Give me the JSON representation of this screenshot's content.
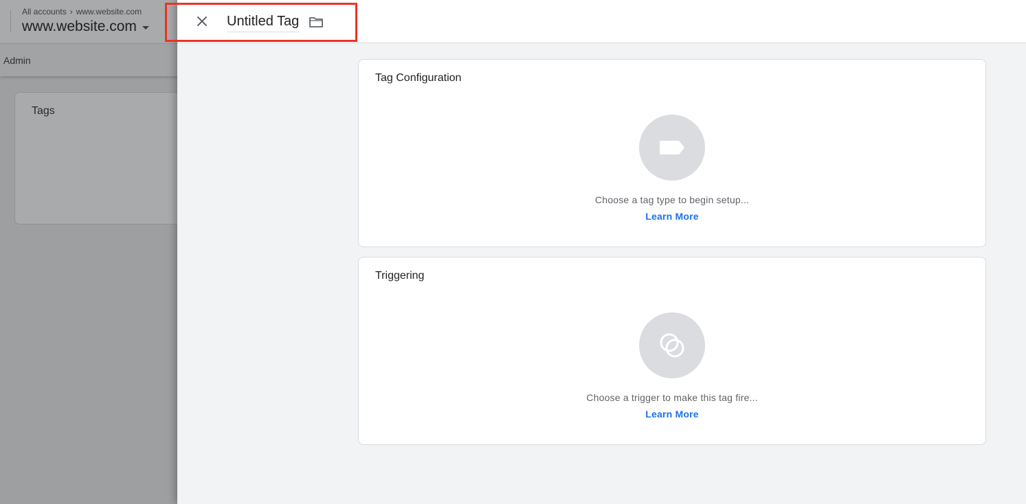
{
  "background": {
    "breadcrumb": {
      "root": "All accounts",
      "current": "www.website.com"
    },
    "container_name": "www.website.com",
    "nav": {
      "admin_label": "Admin"
    },
    "card": {
      "title": "Tags"
    }
  },
  "panel": {
    "title": "Untitled Tag",
    "icons": {
      "close": "close-icon",
      "folder": "folder-icon"
    },
    "highlight_color": "#ea3323",
    "tag_configuration": {
      "title": "Tag Configuration",
      "description": "Choose a tag type to begin setup...",
      "link": "Learn More",
      "icon": "tag-icon"
    },
    "triggering": {
      "title": "Triggering",
      "description": "Choose a trigger to make this tag fire...",
      "link": "Learn More",
      "icon": "trigger-icon"
    }
  },
  "colors": {
    "link": "#1a73e8",
    "circle": "#dadce0",
    "panel_bg": "#f1f3f4"
  }
}
